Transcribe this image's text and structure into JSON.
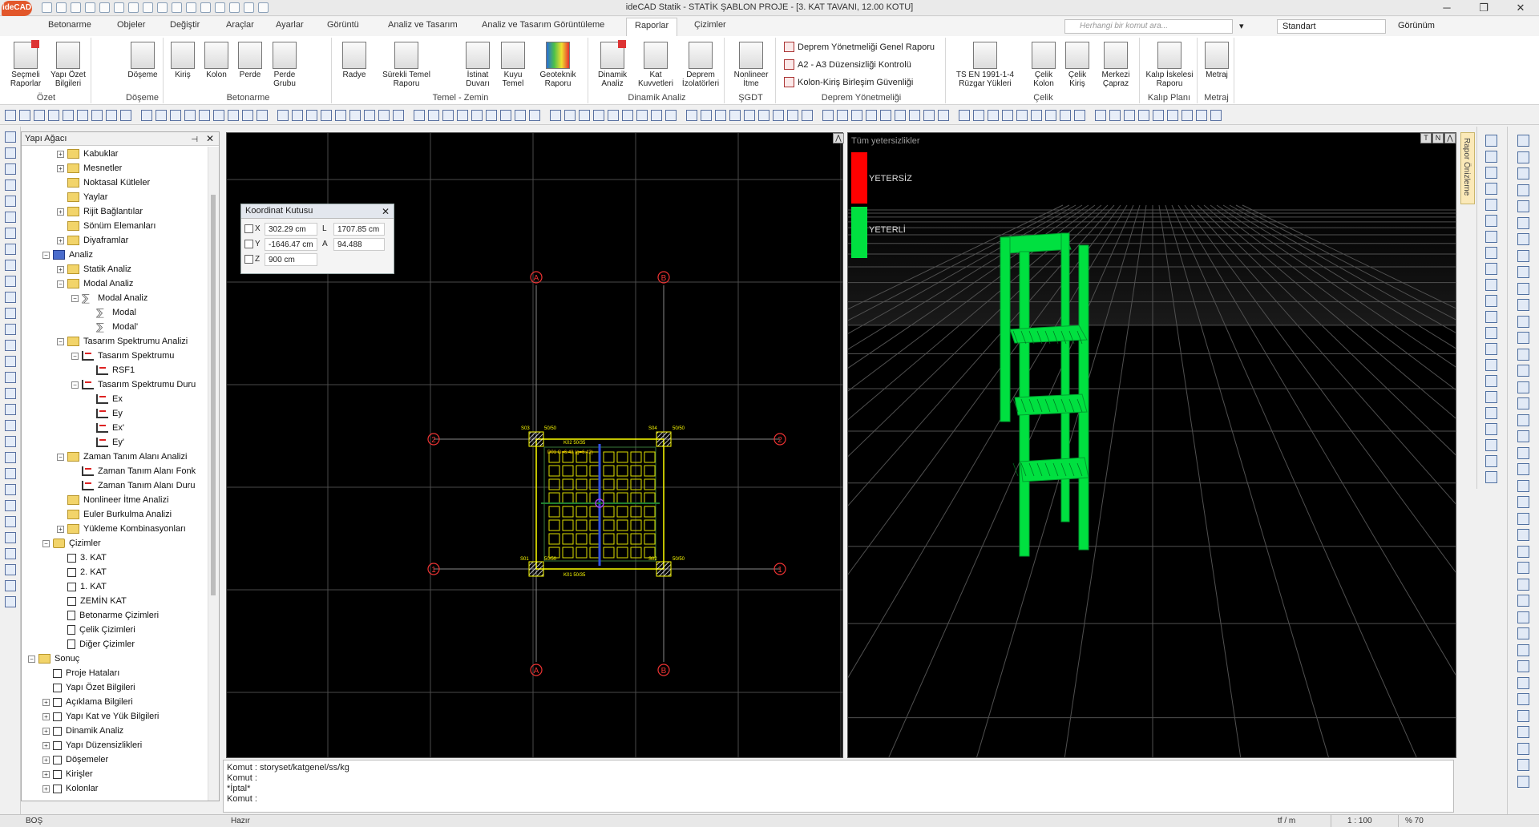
{
  "window": {
    "logo": "ideCAD",
    "title": "ideCAD Statik - STATİK ŞABLON PROJE - [3. KAT TAVANI, 12.00 KOTU]",
    "minimize": "─",
    "maximize": "❐",
    "close": "✕"
  },
  "menu": {
    "tabs": [
      "Betonarme",
      "Objeler",
      "Değiştir",
      "Araçlar",
      "Ayarlar",
      "Görüntü",
      "Analiz ve Tasarım",
      "Analiz ve Tasarım Görüntüleme",
      "Raporlar",
      "Çizimler"
    ],
    "active_tab": "Raporlar",
    "search_placeholder": "Herhangi bir komut ara...",
    "standart": "Standart",
    "gorunum": "Görünüm"
  },
  "ribbon": {
    "groups": {
      "ozet": "Özet",
      "doseme": "Döşeme",
      "betonarme": "Betonarme",
      "temel": "Temel - Zemin",
      "dinamik": "Dinamik Analiz",
      "sgdt": "ŞGDT",
      "deprem": "Deprem Yönetmeliği",
      "celik": "Çelik",
      "kalip": "Kalıp Planı",
      "metraj": "Metraj"
    },
    "buttons": {
      "secmeli": "Seçmeli\nRaporlar",
      "yapi_ozet": "Yapı Özet\nBilgileri",
      "doseme": "Döşeme",
      "kiris": "Kiriş",
      "kolon": "Kolon",
      "perde": "Perde",
      "perde_grubu": "Perde\nGrubu",
      "radye": "Radye",
      "surekli_temel": "Sürekli Temel\nRaporu",
      "istinat": "İstinat\nDuvarı",
      "kuyu": "Kuyu\nTemel",
      "geoteknik": "Geoteknik\nRaporu",
      "dinamik_analiz": "Dinamik\nAnaliz",
      "kat_kuvvetleri": "Kat\nKuvvetleri",
      "deprem_izolator": "Deprem\nİzolatörleri",
      "nonlineer": "Nonlineer\nİtme",
      "ts_en": "TS EN 1991-1-4\nRüzgar Yükleri",
      "celik_kolon": "Çelik\nKolon",
      "celik_kiris": "Çelik\nKiriş",
      "merkezi_capraz": "Merkezi\nÇapraz",
      "kalip_iskelesi": "Kalıp İskelesi\nRaporu",
      "metraj": "Metraj"
    },
    "deprem_items": [
      "Deprem Yönetmeliği Genel Raporu",
      "A2 - A3 Düzensizliği Kontrolü",
      "Kolon-Kiriş Birleşim Güvenliği"
    ]
  },
  "tree": {
    "header": "Yapı Ağacı",
    "items": [
      {
        "label": "Kabuklar",
        "indent": 2,
        "exp": "+",
        "icon": "folder"
      },
      {
        "label": "Mesnetler",
        "indent": 2,
        "exp": "+",
        "icon": "folder"
      },
      {
        "label": "Noktasal Kütleler",
        "indent": 2,
        "exp": "",
        "icon": "folder"
      },
      {
        "label": "Yaylar",
        "indent": 2,
        "exp": "",
        "icon": "folder"
      },
      {
        "label": "Rijit Bağlantılar",
        "indent": 2,
        "exp": "+",
        "icon": "folder"
      },
      {
        "label": "Sönüm Elemanları",
        "indent": 2,
        "exp": "",
        "icon": "folder"
      },
      {
        "label": "Diyaframlar",
        "indent": 2,
        "exp": "+",
        "icon": "folder"
      },
      {
        "label": "Analiz",
        "indent": 1,
        "exp": "−",
        "icon": "anal"
      },
      {
        "label": "Statik Analiz",
        "indent": 2,
        "exp": "+",
        "icon": "folder"
      },
      {
        "label": "Modal Analiz",
        "indent": 2,
        "exp": "−",
        "icon": "folder"
      },
      {
        "label": "Modal Analiz",
        "indent": 3,
        "exp": "−",
        "icon": "mod"
      },
      {
        "label": "Modal",
        "indent": 4,
        "exp": "",
        "icon": "mod"
      },
      {
        "label": "Modal'",
        "indent": 4,
        "exp": "",
        "icon": "mod"
      },
      {
        "label": "Tasarım Spektrumu Analizi",
        "indent": 2,
        "exp": "−",
        "icon": "folder"
      },
      {
        "label": "Tasarım Spektrumu",
        "indent": 3,
        "exp": "−",
        "icon": "spec"
      },
      {
        "label": "RSF1",
        "indent": 4,
        "exp": "",
        "icon": "spec"
      },
      {
        "label": "Tasarım Spektrumu Duru",
        "indent": 3,
        "exp": "−",
        "icon": "spec"
      },
      {
        "label": "Ex",
        "indent": 4,
        "exp": "",
        "icon": "spec"
      },
      {
        "label": "Ey",
        "indent": 4,
        "exp": "",
        "icon": "spec"
      },
      {
        "label": "Ex'",
        "indent": 4,
        "exp": "",
        "icon": "spec"
      },
      {
        "label": "Ey'",
        "indent": 4,
        "exp": "",
        "icon": "spec"
      },
      {
        "label": "Zaman Tanım Alanı Analizi",
        "indent": 2,
        "exp": "−",
        "icon": "folder"
      },
      {
        "label": "Zaman Tanım Alanı Fonk",
        "indent": 3,
        "exp": "",
        "icon": "spec"
      },
      {
        "label": "Zaman Tanım Alanı Duru",
        "indent": 3,
        "exp": "",
        "icon": "spec"
      },
      {
        "label": "Nonlineer İtme Analizi",
        "indent": 2,
        "exp": "",
        "icon": "folder"
      },
      {
        "label": "Euler Burkulma Analizi",
        "indent": 2,
        "exp": "",
        "icon": "folder"
      },
      {
        "label": "Yükleme Kombinasyonları",
        "indent": 2,
        "exp": "+",
        "icon": "folder"
      },
      {
        "label": "Çizimler",
        "indent": 1,
        "exp": "−",
        "icon": "gear"
      },
      {
        "label": "3. KAT",
        "indent": 2,
        "exp": "",
        "icon": "sq"
      },
      {
        "label": "2. KAT",
        "indent": 2,
        "exp": "",
        "icon": "sq"
      },
      {
        "label": "1. KAT",
        "indent": 2,
        "exp": "",
        "icon": "sq"
      },
      {
        "label": "ZEMİN KAT",
        "indent": 2,
        "exp": "",
        "icon": "sq"
      },
      {
        "label": "Betonarme Çizimleri",
        "indent": 2,
        "exp": "",
        "icon": "doc"
      },
      {
        "label": "Çelik Çizimleri",
        "indent": 2,
        "exp": "",
        "icon": "doc"
      },
      {
        "label": "Diğer Çizimler",
        "indent": 2,
        "exp": "",
        "icon": "doc"
      },
      {
        "label": "Sonuç",
        "indent": 0,
        "exp": "−",
        "icon": "folder"
      },
      {
        "label": "Proje Hataları",
        "indent": 1,
        "exp": "",
        "icon": "sq"
      },
      {
        "label": "Yapı Özet Bilgileri",
        "indent": 1,
        "exp": "",
        "icon": "sq"
      },
      {
        "label": "Açıklama Bilgileri",
        "indent": 1,
        "exp": "+",
        "icon": "sq"
      },
      {
        "label": "Yapı Kat ve Yük Bilgileri",
        "indent": 1,
        "exp": "+",
        "icon": "sq"
      },
      {
        "label": "Dinamik Analiz",
        "indent": 1,
        "exp": "+",
        "icon": "sq"
      },
      {
        "label": "Yapı Düzensizlikleri",
        "indent": 1,
        "exp": "+",
        "icon": "sq"
      },
      {
        "label": "Döşemeler",
        "indent": 1,
        "exp": "+",
        "icon": "sq"
      },
      {
        "label": "Kirişler",
        "indent": 1,
        "exp": "+",
        "icon": "sq"
      },
      {
        "label": "Kolonlar",
        "indent": 1,
        "exp": "+",
        "icon": "sq"
      }
    ]
  },
  "coord_box": {
    "title": "Koordinat Kutusu",
    "x_label": "X",
    "x_value": "302.29 cm",
    "y_label": "Y",
    "y_value": "-1646.47 cm",
    "z_label": "Z",
    "z_value": "900 cm",
    "l_label": "L",
    "l_value": "1707.85 cm",
    "a_label": "A",
    "a_value": "94.488"
  },
  "plan": {
    "axis_labels": {
      "a": "A",
      "b": "B",
      "one": "1",
      "two": "2"
    },
    "column_labels": [
      "S03",
      "50/50",
      "S04",
      "50/50",
      "S01",
      "50/50",
      "S02",
      "50/50"
    ],
    "beam_labels": [
      "K02 50/35",
      "K01 50/35",
      "K03 50/35",
      "K04 50/35"
    ],
    "slab_label": "D01 G=6.42 (g=6.42)"
  },
  "view3d": {
    "header": "Tüm yetersizlikler",
    "legend_bad": "YETERSİZ",
    "legend_good": "YETERLİ",
    "btn_t": "T",
    "btn_n": "N",
    "btn_up": "⋀",
    "colors": {
      "bad": "#ff0000",
      "good": "#00e040"
    }
  },
  "rapor_onizleme": "Rapor Önizleme",
  "command": {
    "lines": [
      "Komut : storyset/katgenel/ss/kg",
      "Komut :",
      "*İptal*",
      "Komut :"
    ]
  },
  "status": {
    "left": "BOŞ",
    "ready": "Hazır",
    "unit": "tf / m",
    "scale": "1 : 100",
    "zoom": "% 70"
  }
}
